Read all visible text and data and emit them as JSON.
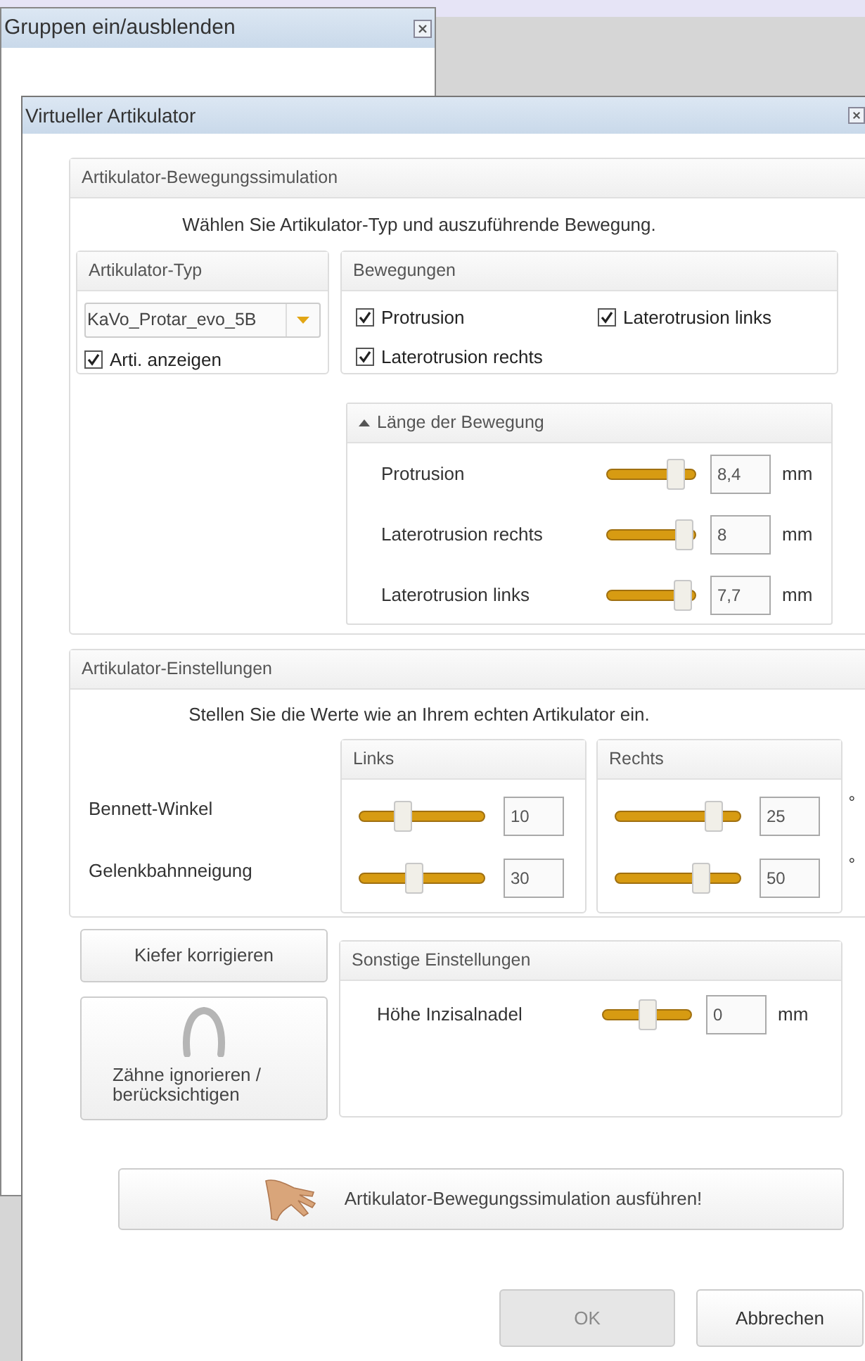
{
  "background_window": {
    "title": "Gruppen ein/ausblenden"
  },
  "dialog": {
    "title": "Virtueller Artikulator"
  },
  "simulation": {
    "title": "Artikulator-Bewegungssimulation",
    "instruction": "Wählen Sie Artikulator-Typ und auszuführende Bewegung.",
    "type_group": {
      "title": "Artikulator-Typ",
      "dropdown_value": "KaVo_Protar_evo_5B",
      "show_checkbox": {
        "label": "Arti. anzeigen",
        "checked": true
      }
    },
    "movements_group": {
      "title": "Bewegungen",
      "options": [
        {
          "label": "Protrusion",
          "checked": true
        },
        {
          "label": "Laterotrusion links",
          "checked": true
        },
        {
          "label": "Laterotrusion rechts",
          "checked": true
        }
      ]
    },
    "length_group": {
      "title": "Länge der Bewegung",
      "expanded": true,
      "rows": [
        {
          "label": "Protrusion",
          "level": 0.84,
          "value": "8,4",
          "unit": "mm"
        },
        {
          "label": "Laterotrusion rechts",
          "level": 0.96,
          "value": "8",
          "unit": "mm"
        },
        {
          "label": "Laterotrusion links",
          "level": 0.94,
          "value": "7,7",
          "unit": "mm"
        }
      ]
    }
  },
  "settings": {
    "title": "Artikulator-Einstellungen",
    "instruction": "Stellen Sie die Werte wie an Ihrem echten Artikulator ein.",
    "columns": [
      "Links",
      "Rechts"
    ],
    "rows": [
      {
        "label": "Bennett-Winkel",
        "left": {
          "level": 0.33,
          "value": "10"
        },
        "right": {
          "level": 0.83,
          "value": "25"
        },
        "unit": "°"
      },
      {
        "label": "Gelenkbahnneigung",
        "left": {
          "level": 0.43,
          "value": "30"
        },
        "right": {
          "level": 0.72,
          "value": "50"
        },
        "unit": "°"
      }
    ]
  },
  "side_buttons": [
    "Kiefer korrigieren",
    "Zähne ignorieren / berücksichtigen"
  ],
  "other_settings": {
    "title": "Sonstige Einstellungen",
    "rows": [
      {
        "label": "Höhe Inzisalnadel",
        "level": 0.5,
        "value": "0",
        "unit": "mm"
      }
    ]
  },
  "run_button": "Artikulator-Bewegungssimulation ausführen!",
  "buttons": [
    {
      "label": "OK",
      "disabled": true
    },
    {
      "label": "Abbrechen",
      "disabled": false
    }
  ]
}
